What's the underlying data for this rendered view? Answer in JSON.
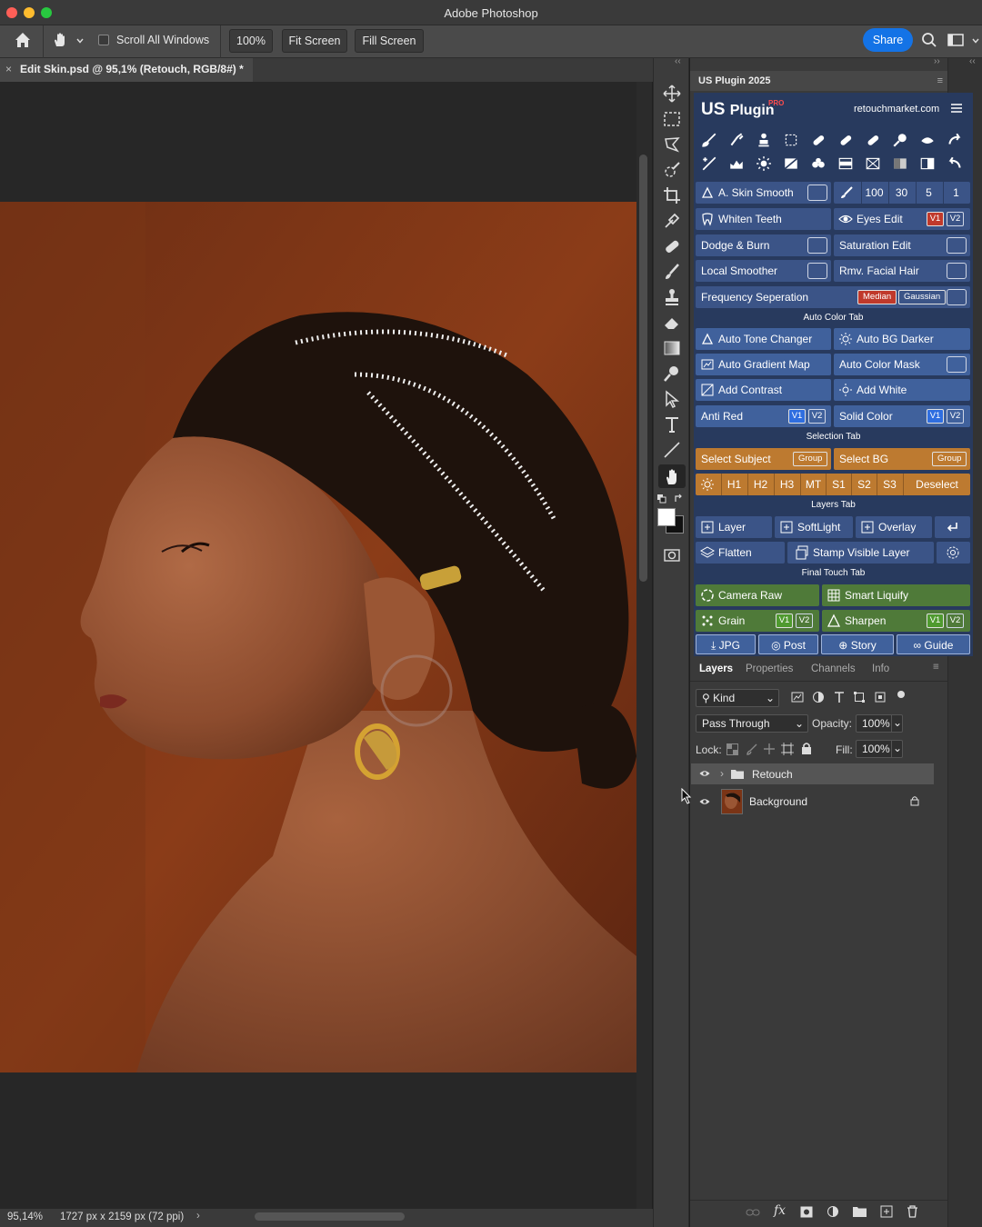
{
  "window": {
    "title": "Adobe Photoshop"
  },
  "options_bar": {
    "scroll_all_label": "Scroll All Windows",
    "zoom_label": "100%",
    "fit_screen_label": "Fit Screen",
    "fill_screen_label": "Fill Screen",
    "share_label": "Share"
  },
  "document": {
    "tab_title": "Edit Skin.psd @ 95,1% (Retouch, RGB/8#) *",
    "close_glyph": "×"
  },
  "status": {
    "zoom": "95,14%",
    "info": "1727 px x 2159 px (72 ppi)",
    "arrow": "›"
  },
  "plugin": {
    "panel_title": "US Plugin 2025",
    "logo_text": "Plugin",
    "logo_us": "US",
    "logo_pro": "PRO",
    "website": "retouchmarket.com",
    "brush_values": [
      "100",
      "30",
      "5",
      "1"
    ],
    "rows": {
      "skin_smooth": "A. Skin Smooth",
      "whiten_teeth": "Whiten Teeth",
      "eyes_edit": "Eyes Edit",
      "dodge_burn": "Dodge & Burn",
      "saturation_edit": "Saturation Edit",
      "local_smoother": "Local Smoother",
      "rmv_facial_hair": "Rmv. Facial Hair",
      "frequency_sep": "Frequency Seperation",
      "median": "Median",
      "gaussian": "Gaussian"
    },
    "auto_color_tab": {
      "title": "Auto Color Tab",
      "auto_tone_changer": "Auto Tone Changer",
      "auto_bg_darker": "Auto BG Darker",
      "auto_gradient_map": "Auto Gradient Map",
      "auto_color_mask": "Auto Color Mask",
      "add_contrast": "Add Contrast",
      "add_white": "Add White",
      "anti_red": "Anti Red",
      "solid_color": "Solid Color"
    },
    "selection_tab": {
      "title": "Selection Tab",
      "select_subject": "Select Subject",
      "select_bg": "Select BG",
      "group": "Group",
      "chips": [
        "H1",
        "H2",
        "H3",
        "MT",
        "S1",
        "S2",
        "S3"
      ],
      "deselect": "Deselect"
    },
    "layers_tab": {
      "title": "Layers Tab",
      "layer": "Layer",
      "softlight": "SoftLight",
      "overlay": "Overlay",
      "flatten": "Flatten",
      "stamp_visible": "Stamp Visible Layer"
    },
    "final_touch_tab": {
      "title": "Final Touch Tab",
      "camera_raw": "Camera Raw",
      "smart_liquify": "Smart Liquify",
      "grain": "Grain",
      "sharpen": "Sharpen",
      "jpg": "JPG",
      "post": "Post",
      "story": "Story",
      "guide": "Guide"
    },
    "v1": "V1",
    "v2": "V2"
  },
  "layers_panel": {
    "tabs": [
      "Layers",
      "Properties",
      "Channels",
      "Info"
    ],
    "kind_label": "Kind",
    "blend_mode": "Pass Through",
    "opacity_label": "Opacity:",
    "opacity_value": "100%",
    "lock_label": "Lock:",
    "fill_label": "Fill:",
    "fill_value": "100%",
    "layers": [
      {
        "name": "Retouch"
      },
      {
        "name": "Background"
      }
    ]
  },
  "colors": {
    "share": "#1473e6",
    "plugin_bg": "#283a5e",
    "plugin_button": "#3b5487",
    "selection_orange": "#bd7a30",
    "final_green": "#4f7a39"
  }
}
